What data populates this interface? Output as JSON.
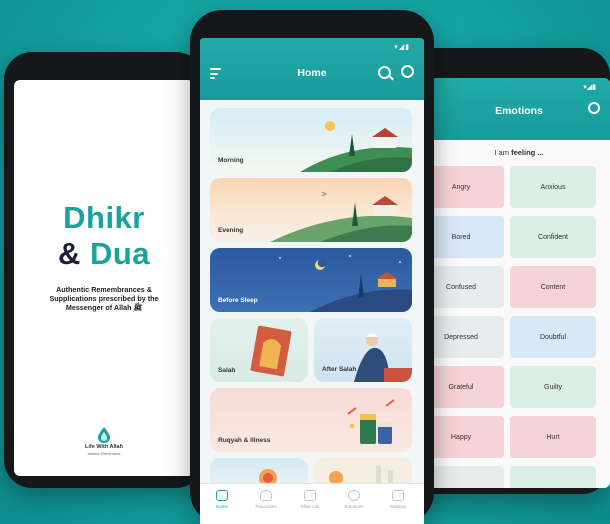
{
  "splash": {
    "title_line1": "Dhikr",
    "title_amp": "&",
    "title_line2": "Dua",
    "tagline": "Authentic Remembrances & Supplications prescribed by the Messenger of Allah ﷺ",
    "brand_name": "Life With Allah",
    "brand_sub": "Islamic Reminders"
  },
  "home": {
    "title": "Home",
    "cards": [
      {
        "label": "Morning"
      },
      {
        "label": "Evening"
      },
      {
        "label": "Before Sleep"
      },
      {
        "label": "Salah"
      },
      {
        "label": "After Salah"
      },
      {
        "label": "Ruqyah & Illness"
      }
    ],
    "nav": [
      {
        "label": "Home",
        "active": true
      },
      {
        "label": "Favourites"
      },
      {
        "label": "Dhikr List"
      },
      {
        "label": "Emotions"
      },
      {
        "label": "Settings"
      }
    ]
  },
  "emotions": {
    "title": "Emotions",
    "subtitle_prefix": "I am",
    "subtitle_bold": "feeling ...",
    "items": [
      {
        "label": "Angry",
        "color": "#f6d3d6"
      },
      {
        "label": "Anxious",
        "color": "#dbefe6"
      },
      {
        "label": "Bored",
        "color": "#d8e8f7"
      },
      {
        "label": "Confident",
        "color": "#dbefe6"
      },
      {
        "label": "Confused",
        "color": "#e8ecec"
      },
      {
        "label": "Content",
        "color": "#f6d3d6"
      },
      {
        "label": "Depressed",
        "color": "#e8ecec"
      },
      {
        "label": "Doubtful",
        "color": "#d8e8f7"
      },
      {
        "label": "Grateful",
        "color": "#f6d3d6"
      },
      {
        "label": "Guilty",
        "color": "#dbefe6"
      },
      {
        "label": "Happy",
        "color": "#f6d3d6"
      },
      {
        "label": "Hurt",
        "color": "#f6d3d6"
      }
    ]
  },
  "colors": {
    "teal": "#1aa39d",
    "navy": "#1b1e3c",
    "background": "#14a3a2"
  }
}
